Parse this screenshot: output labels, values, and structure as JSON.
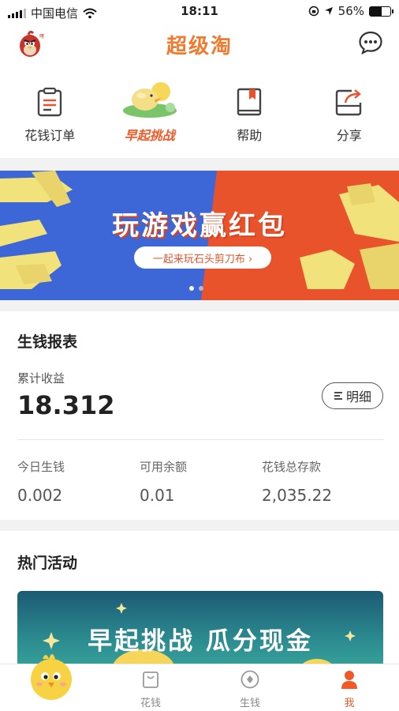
{
  "status_bar": {
    "carrier": "中国电信",
    "time": "18:11",
    "battery": "56%",
    "battery_level": 0.56
  },
  "header": {
    "brand": "超级淘"
  },
  "quick_actions": [
    {
      "label": "花钱订单",
      "icon": "clipboard-icon"
    },
    {
      "label": "早起挑战",
      "icon": "chick-illustration"
    },
    {
      "label": "帮助",
      "icon": "book-icon"
    },
    {
      "label": "分享",
      "icon": "share-icon"
    }
  ],
  "banner": {
    "title": "玩游戏赢红包",
    "subtitle": "一起来玩石头剪刀布 ›",
    "page_count": 2,
    "active_page": 1
  },
  "report": {
    "title": "生钱报表",
    "cumulative_label": "累计收益",
    "cumulative_value": "18.312",
    "detail_button": "明细",
    "stats": [
      {
        "label": "今日生钱",
        "value": "0.002"
      },
      {
        "label": "可用余额",
        "value": "0.01"
      },
      {
        "label": "花钱总存款",
        "value": "2,035.22"
      }
    ]
  },
  "hot": {
    "title": "热门活动",
    "card_title": "早起挑战 瓜分现金"
  },
  "tabbar": [
    {
      "label": "花钱",
      "icon": "bag-icon",
      "active": false
    },
    {
      "label": "生钱",
      "icon": "coin-icon",
      "active": false
    },
    {
      "label": "我",
      "icon": "person-icon",
      "active": true
    }
  ],
  "colors": {
    "accent": "#f05a28",
    "brand": "#f07a2e",
    "banner_blue": "#3d66d6",
    "banner_red": "#e8532b"
  }
}
